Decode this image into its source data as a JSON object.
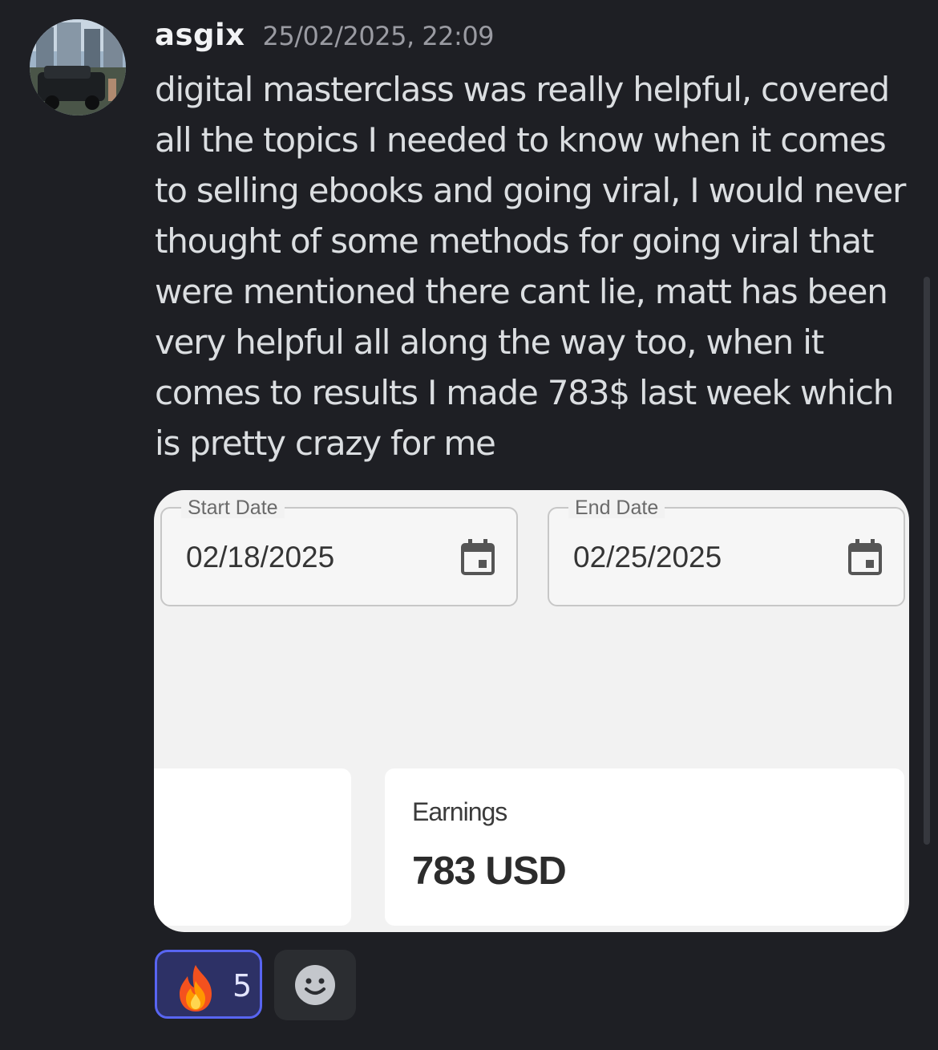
{
  "message": {
    "author": "asgix",
    "timestamp": "25/02/2025, 22:09",
    "text": "digital masterclass was really helpful, covered all the topics I needed to know when it comes to selling ebooks and going viral, I would never thought of some methods for going viral that were mentioned there cant lie, matt has been very helpful all along the way too, when it comes to results I made 783$ last week which is pretty crazy for me"
  },
  "embed": {
    "start_date": {
      "label": "Start Date",
      "value": "02/18/2025",
      "icon": "calendar-icon"
    },
    "end_date": {
      "label": "End Date",
      "value": "02/25/2025",
      "icon": "calendar-icon"
    },
    "earnings": {
      "label": "Earnings",
      "value": "783 USD"
    }
  },
  "reactions": [
    {
      "icon": "fire-emoji",
      "count": "5",
      "active": true
    }
  ],
  "add_reaction": {
    "icon": "smiley-icon"
  },
  "colors": {
    "background": "#1e1f24",
    "username": "#f2f3f5",
    "message_text": "#dbdee1",
    "timestamp": "#9a9ba2",
    "reaction_border": "#5865f2",
    "reaction_bg": "#2d3166"
  }
}
